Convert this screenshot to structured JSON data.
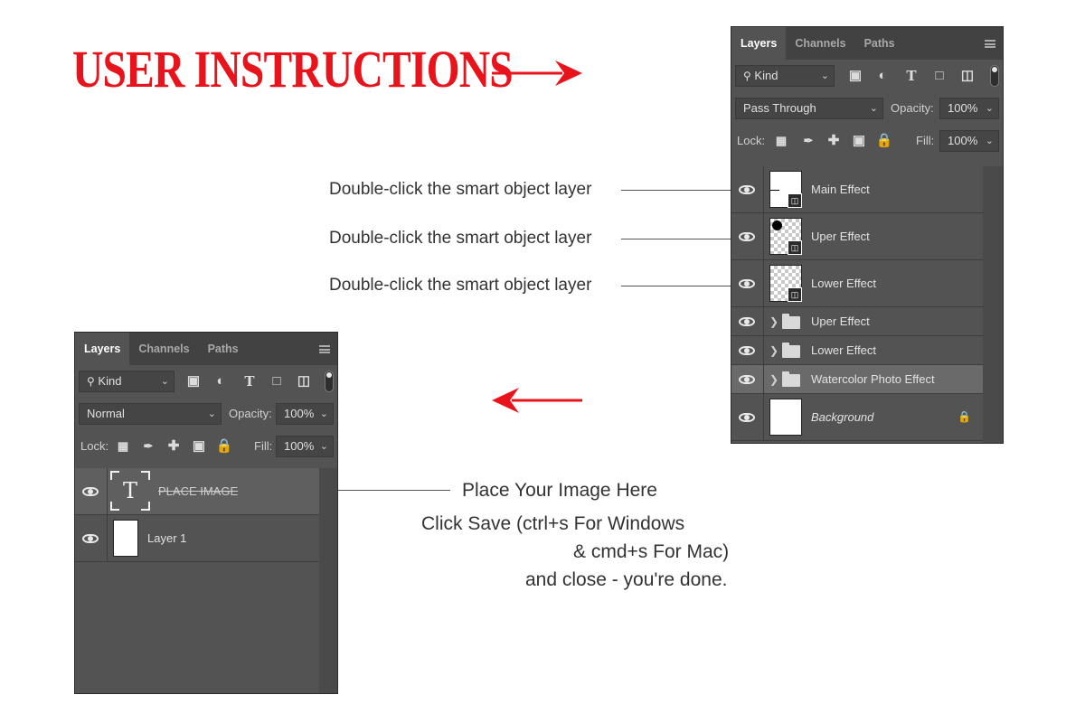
{
  "title": "USER INSTRUCTIONS",
  "colors": {
    "accent": "#e8131b",
    "panel_bg": "#535353",
    "panel_header": "#424242",
    "selected_row": "#6a6a6a"
  },
  "annotations": {
    "smart_object_1": "Double-click the smart object layer",
    "smart_object_2": "Double-click the smart object layer",
    "smart_object_3": "Double-click the smart object layer",
    "place_image": "Place Your Image Here",
    "save_line1": "Click Save (ctrl+s For Windows",
    "save_line2": "& cmd+s For Mac)",
    "save_line3": "and close - you're done."
  },
  "right_panel": {
    "tabs": [
      "Layers",
      "Channels",
      "Paths"
    ],
    "filter_label": "Kind",
    "blend_mode": "Pass Through",
    "opacity_label": "Opacity:",
    "opacity_value": "100%",
    "lock_label": "Lock:",
    "fill_label": "Fill:",
    "fill_value": "100%",
    "layers": [
      {
        "name": "Main Effect",
        "kind": "smart-object"
      },
      {
        "name": "Uper Effect",
        "kind": "smart-object"
      },
      {
        "name": "Lower Effect",
        "kind": "smart-object"
      },
      {
        "name": "Uper Effect",
        "kind": "group"
      },
      {
        "name": "Lower Effect",
        "kind": "group"
      },
      {
        "name": "Watercolor Photo Effect",
        "kind": "group",
        "selected": true
      },
      {
        "name": "Background",
        "kind": "background",
        "locked": true
      }
    ]
  },
  "left_panel": {
    "tabs": [
      "Layers",
      "Channels",
      "Paths"
    ],
    "filter_label": "Kind",
    "blend_mode": "Normal",
    "opacity_label": "Opacity:",
    "opacity_value": "100%",
    "lock_label": "Lock:",
    "fill_label": "Fill:",
    "fill_value": "100%",
    "layers": [
      {
        "name": "PLACE IMAGE",
        "kind": "text",
        "selected": true
      },
      {
        "name": "Layer 1",
        "kind": "pixel"
      }
    ]
  },
  "icons": [
    "arrow-right-icon",
    "arrow-left-icon",
    "search-icon",
    "image-filter-icon",
    "adjustment-filter-icon",
    "type-filter-icon",
    "shape-filter-icon",
    "smart-filter-icon",
    "eye-icon",
    "folder-icon",
    "lock-icon",
    "chevron-down-icon",
    "panel-menu-icon"
  ]
}
